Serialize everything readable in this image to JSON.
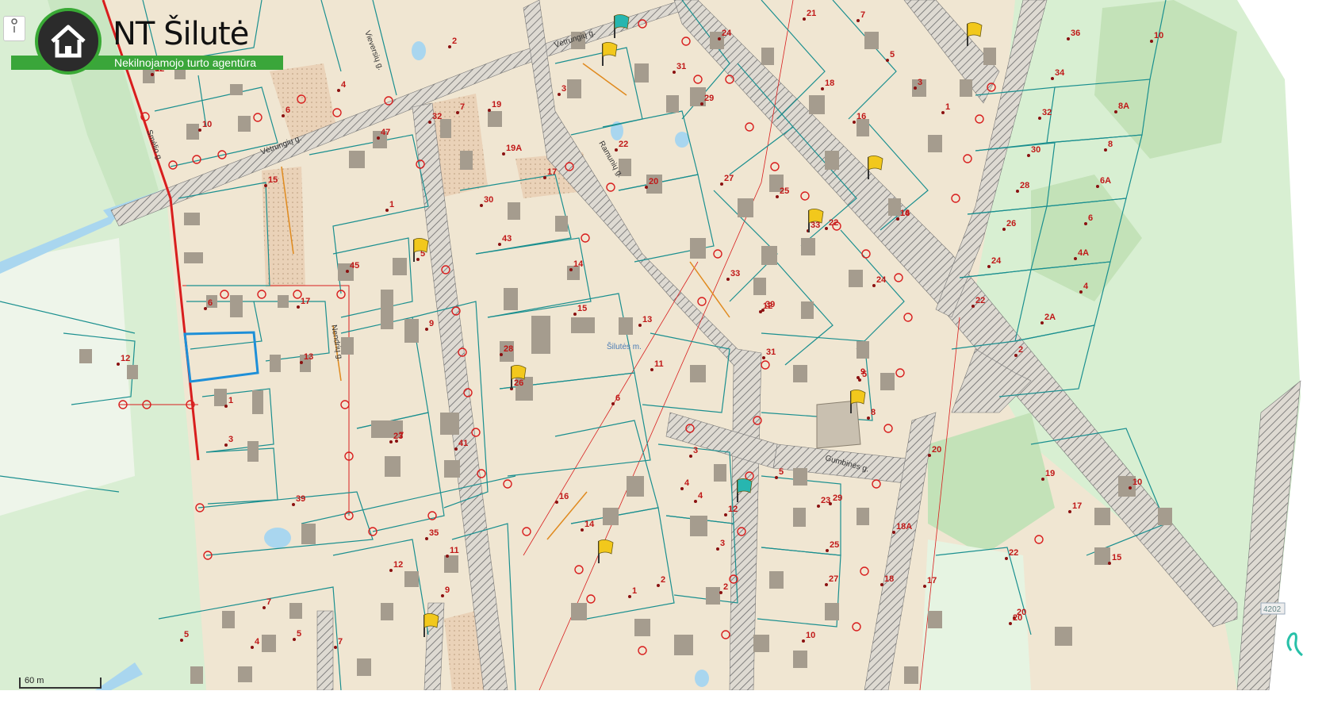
{
  "brand": {
    "title": "NT Šilutė",
    "subtitle": "Nekilnojamojo turto agentūra",
    "colors": {
      "green": "#3aa63a",
      "dark": "#2b2b2b"
    }
  },
  "scale": {
    "label": "60 m"
  },
  "road_badge": "4202",
  "colors": {
    "land": "#f0e6d2",
    "forest": "#c9e6c2",
    "meadow": "#d8efd2",
    "road": "#cfcfcf",
    "parcel_line": "#1a8f8f",
    "utility_red": "#d81e1e",
    "water": "#a9d6ef",
    "building": "#a59c8e",
    "selected_parcel": "#1e8fd8",
    "flag_yellow": "#f2c81c",
    "flag_teal": "#27b6b0"
  },
  "streets": [
    "Vėtrungių g.",
    "Vėtrungių g.",
    "Vieversių g.",
    "Šilutės m.",
    "Gumbinės g.",
    "Nendrių g.",
    "Ramunių g.",
    "Smėlio g."
  ],
  "house_numbers": [
    "9",
    "10",
    "4",
    "6",
    "2",
    "47",
    "32",
    "7",
    "19",
    "19A",
    "17",
    "30",
    "3",
    "31",
    "22",
    "24",
    "29",
    "20",
    "18",
    "16",
    "27",
    "25",
    "1",
    "3",
    "5",
    "7",
    "36",
    "34",
    "10",
    "8A",
    "32",
    "30",
    "8",
    "6A",
    "28",
    "26",
    "6",
    "24",
    "4A",
    "22",
    "4",
    "2A",
    "2",
    "20",
    "15",
    "1",
    "45",
    "5",
    "43",
    "28",
    "26",
    "24",
    "22",
    "21",
    "15",
    "13",
    "11",
    "9",
    "7",
    "41",
    "39",
    "35",
    "12",
    "11",
    "9",
    "7",
    "5",
    "4",
    "7",
    "5",
    "3",
    "1",
    "6",
    "17",
    "13",
    "12",
    "14",
    "16",
    "12",
    "33",
    "31",
    "9",
    "8",
    "6",
    "5",
    "3",
    "4",
    "2",
    "1",
    "10",
    "20",
    "23",
    "25",
    "27",
    "29",
    "18A",
    "18",
    "17",
    "22",
    "20",
    "19",
    "17",
    "10",
    "15",
    "14",
    "16",
    "12",
    "2",
    "3",
    "4",
    "5",
    "33",
    "23",
    "39",
    "14",
    "12"
  ],
  "flags": [
    "yellow",
    "yellow",
    "teal",
    "yellow",
    "yellow",
    "yellow",
    "yellow",
    "yellow",
    "teal",
    "yellow",
    "yellow"
  ]
}
